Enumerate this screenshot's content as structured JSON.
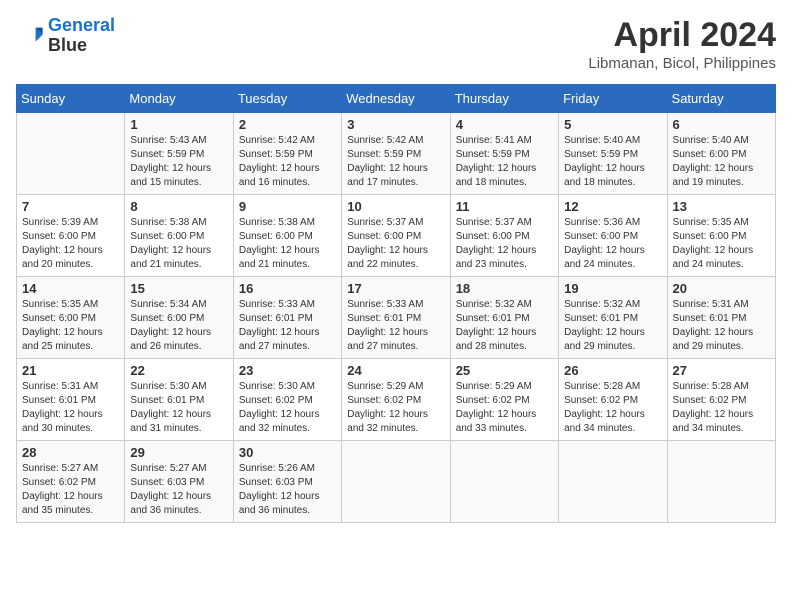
{
  "logo": {
    "line1": "General",
    "line2": "Blue"
  },
  "title": "April 2024",
  "location": "Libmanan, Bicol, Philippines",
  "weekdays": [
    "Sunday",
    "Monday",
    "Tuesday",
    "Wednesday",
    "Thursday",
    "Friday",
    "Saturday"
  ],
  "weeks": [
    [
      {
        "day": "",
        "info": ""
      },
      {
        "day": "1",
        "info": "Sunrise: 5:43 AM\nSunset: 5:59 PM\nDaylight: 12 hours\nand 15 minutes."
      },
      {
        "day": "2",
        "info": "Sunrise: 5:42 AM\nSunset: 5:59 PM\nDaylight: 12 hours\nand 16 minutes."
      },
      {
        "day": "3",
        "info": "Sunrise: 5:42 AM\nSunset: 5:59 PM\nDaylight: 12 hours\nand 17 minutes."
      },
      {
        "day": "4",
        "info": "Sunrise: 5:41 AM\nSunset: 5:59 PM\nDaylight: 12 hours\nand 18 minutes."
      },
      {
        "day": "5",
        "info": "Sunrise: 5:40 AM\nSunset: 5:59 PM\nDaylight: 12 hours\nand 18 minutes."
      },
      {
        "day": "6",
        "info": "Sunrise: 5:40 AM\nSunset: 6:00 PM\nDaylight: 12 hours\nand 19 minutes."
      }
    ],
    [
      {
        "day": "7",
        "info": "Sunrise: 5:39 AM\nSunset: 6:00 PM\nDaylight: 12 hours\nand 20 minutes."
      },
      {
        "day": "8",
        "info": "Sunrise: 5:38 AM\nSunset: 6:00 PM\nDaylight: 12 hours\nand 21 minutes."
      },
      {
        "day": "9",
        "info": "Sunrise: 5:38 AM\nSunset: 6:00 PM\nDaylight: 12 hours\nand 21 minutes."
      },
      {
        "day": "10",
        "info": "Sunrise: 5:37 AM\nSunset: 6:00 PM\nDaylight: 12 hours\nand 22 minutes."
      },
      {
        "day": "11",
        "info": "Sunrise: 5:37 AM\nSunset: 6:00 PM\nDaylight: 12 hours\nand 23 minutes."
      },
      {
        "day": "12",
        "info": "Sunrise: 5:36 AM\nSunset: 6:00 PM\nDaylight: 12 hours\nand 24 minutes."
      },
      {
        "day": "13",
        "info": "Sunrise: 5:35 AM\nSunset: 6:00 PM\nDaylight: 12 hours\nand 24 minutes."
      }
    ],
    [
      {
        "day": "14",
        "info": "Sunrise: 5:35 AM\nSunset: 6:00 PM\nDaylight: 12 hours\nand 25 minutes."
      },
      {
        "day": "15",
        "info": "Sunrise: 5:34 AM\nSunset: 6:00 PM\nDaylight: 12 hours\nand 26 minutes."
      },
      {
        "day": "16",
        "info": "Sunrise: 5:33 AM\nSunset: 6:01 PM\nDaylight: 12 hours\nand 27 minutes."
      },
      {
        "day": "17",
        "info": "Sunrise: 5:33 AM\nSunset: 6:01 PM\nDaylight: 12 hours\nand 27 minutes."
      },
      {
        "day": "18",
        "info": "Sunrise: 5:32 AM\nSunset: 6:01 PM\nDaylight: 12 hours\nand 28 minutes."
      },
      {
        "day": "19",
        "info": "Sunrise: 5:32 AM\nSunset: 6:01 PM\nDaylight: 12 hours\nand 29 minutes."
      },
      {
        "day": "20",
        "info": "Sunrise: 5:31 AM\nSunset: 6:01 PM\nDaylight: 12 hours\nand 29 minutes."
      }
    ],
    [
      {
        "day": "21",
        "info": "Sunrise: 5:31 AM\nSunset: 6:01 PM\nDaylight: 12 hours\nand 30 minutes."
      },
      {
        "day": "22",
        "info": "Sunrise: 5:30 AM\nSunset: 6:01 PM\nDaylight: 12 hours\nand 31 minutes."
      },
      {
        "day": "23",
        "info": "Sunrise: 5:30 AM\nSunset: 6:02 PM\nDaylight: 12 hours\nand 32 minutes."
      },
      {
        "day": "24",
        "info": "Sunrise: 5:29 AM\nSunset: 6:02 PM\nDaylight: 12 hours\nand 32 minutes."
      },
      {
        "day": "25",
        "info": "Sunrise: 5:29 AM\nSunset: 6:02 PM\nDaylight: 12 hours\nand 33 minutes."
      },
      {
        "day": "26",
        "info": "Sunrise: 5:28 AM\nSunset: 6:02 PM\nDaylight: 12 hours\nand 34 minutes."
      },
      {
        "day": "27",
        "info": "Sunrise: 5:28 AM\nSunset: 6:02 PM\nDaylight: 12 hours\nand 34 minutes."
      }
    ],
    [
      {
        "day": "28",
        "info": "Sunrise: 5:27 AM\nSunset: 6:02 PM\nDaylight: 12 hours\nand 35 minutes."
      },
      {
        "day": "29",
        "info": "Sunrise: 5:27 AM\nSunset: 6:03 PM\nDaylight: 12 hours\nand 36 minutes."
      },
      {
        "day": "30",
        "info": "Sunrise: 5:26 AM\nSunset: 6:03 PM\nDaylight: 12 hours\nand 36 minutes."
      },
      {
        "day": "",
        "info": ""
      },
      {
        "day": "",
        "info": ""
      },
      {
        "day": "",
        "info": ""
      },
      {
        "day": "",
        "info": ""
      }
    ]
  ]
}
